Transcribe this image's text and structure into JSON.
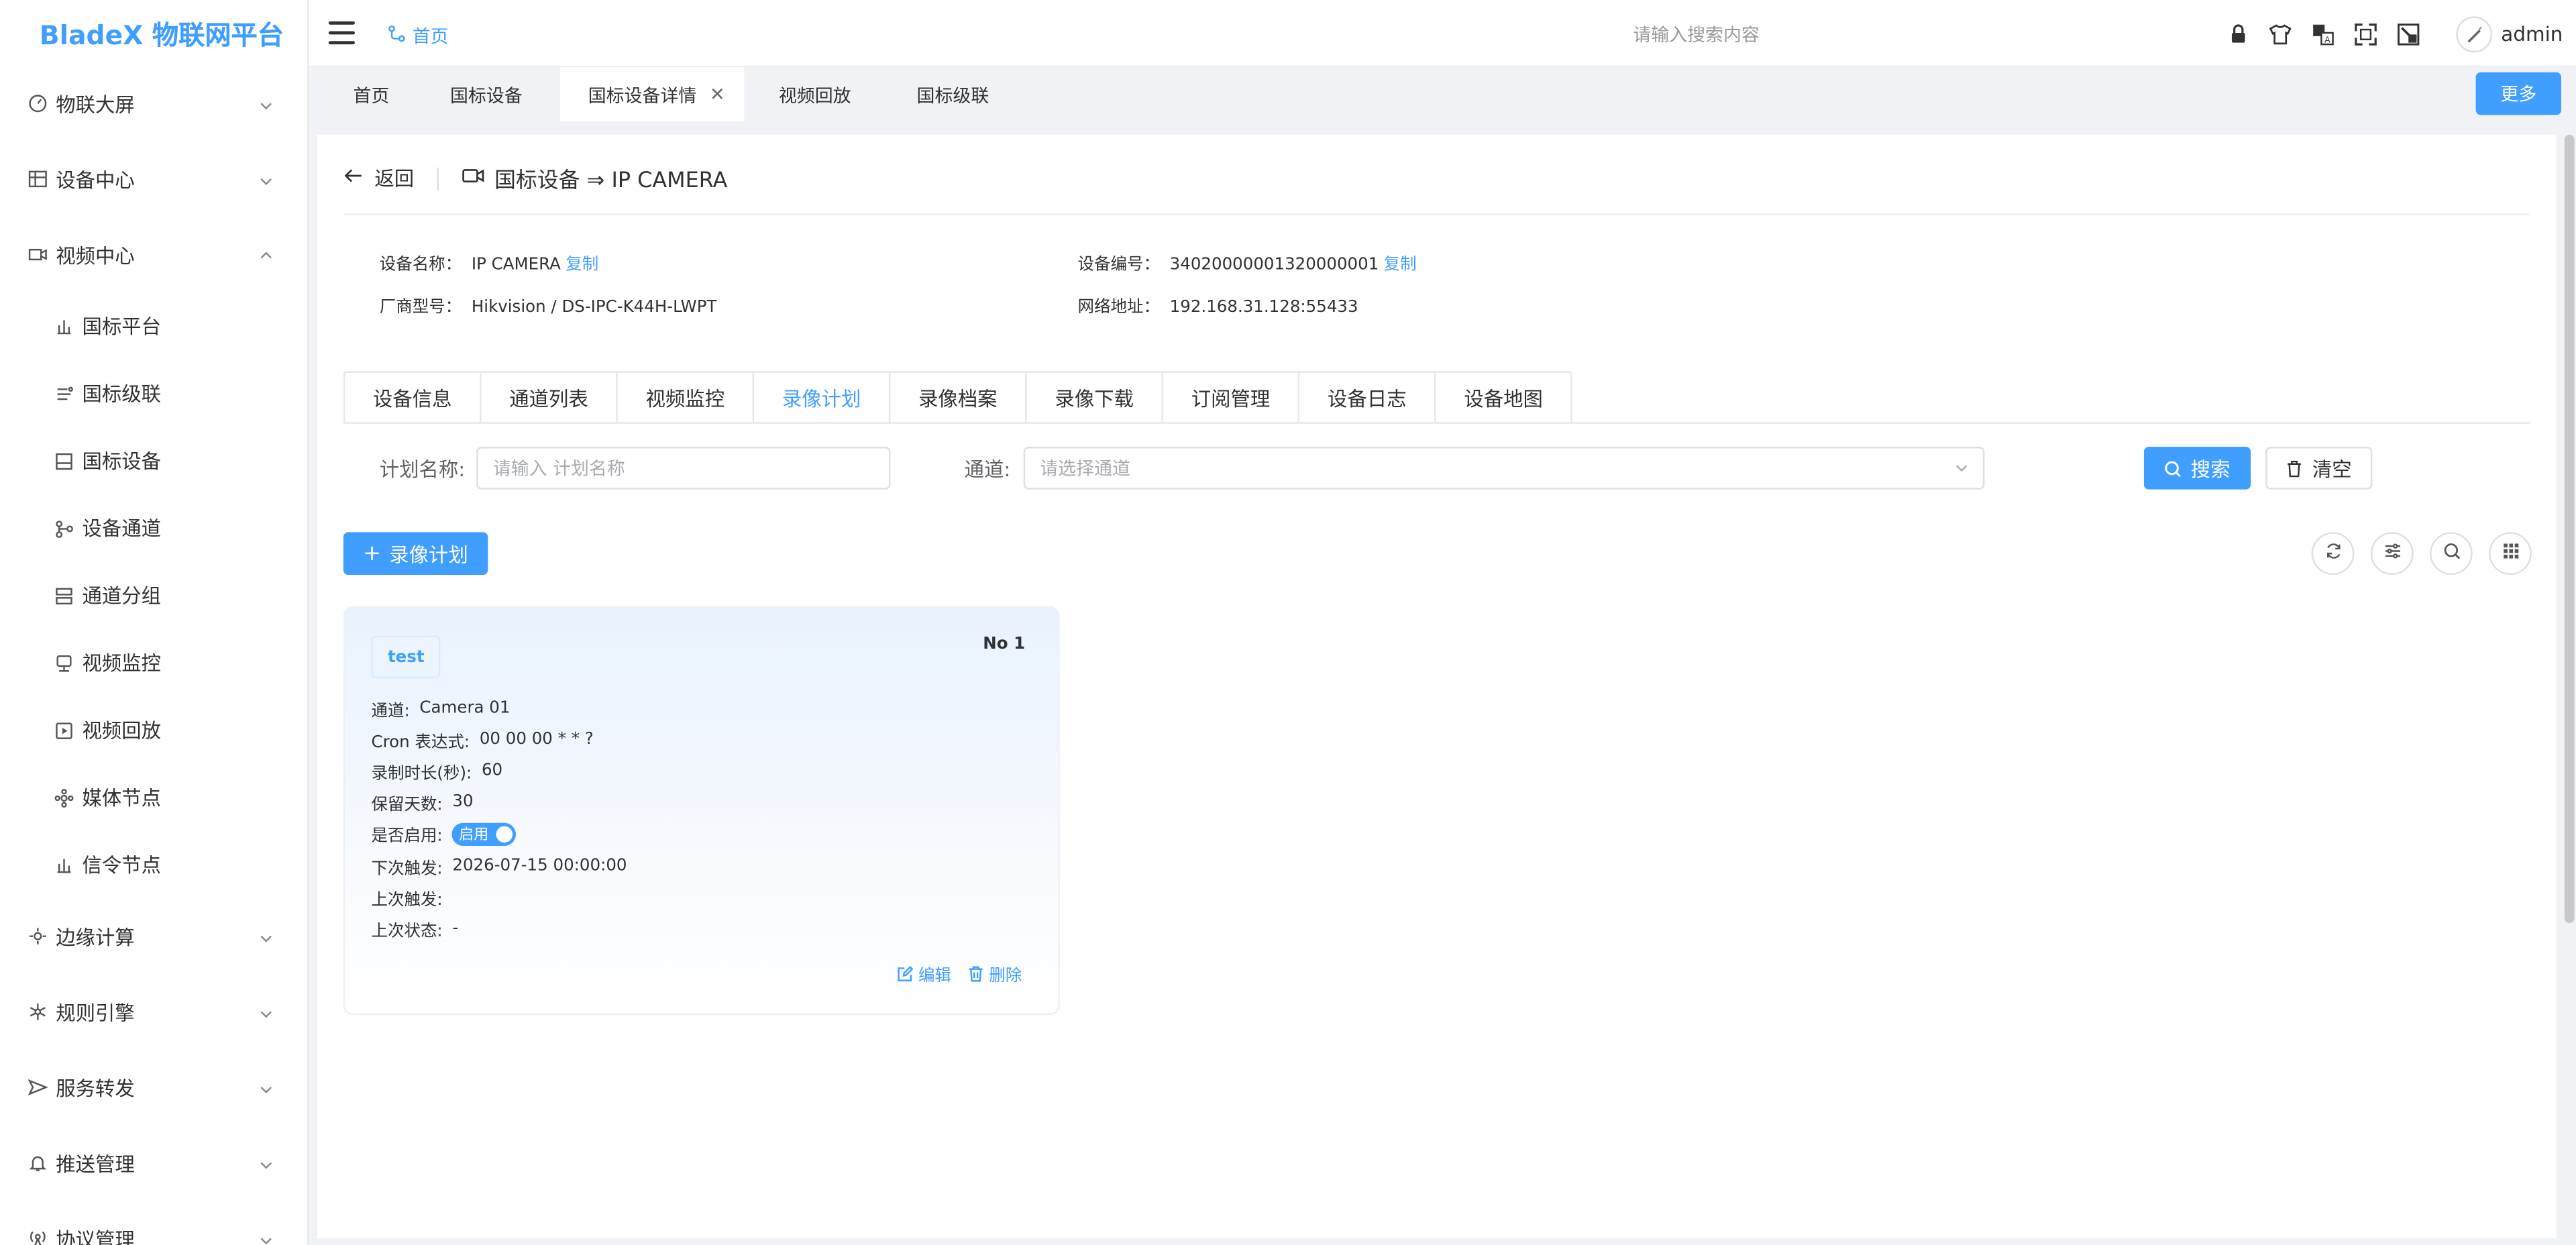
{
  "app": {
    "logo": "BladeX 物联网平台"
  },
  "header": {
    "home_crumb": "首页",
    "search_placeholder": "请输入搜索内容",
    "user_name": "admin"
  },
  "sidebar": {
    "items": [
      {
        "label": "物联大屏",
        "icon": "dashboard-icon",
        "expanded": false
      },
      {
        "label": "设备中心",
        "icon": "device-center-icon",
        "expanded": false
      },
      {
        "label": "视频中心",
        "icon": "video-icon",
        "expanded": true,
        "children": [
          {
            "label": "国标平台",
            "icon": "platform-icon"
          },
          {
            "label": "国标级联",
            "icon": "cascade-icon"
          },
          {
            "label": "国标设备",
            "icon": "device-icon"
          },
          {
            "label": "设备通道",
            "icon": "channel-icon"
          },
          {
            "label": "通道分组",
            "icon": "group-icon"
          },
          {
            "label": "视频监控",
            "icon": "monitor-icon"
          },
          {
            "label": "视频回放",
            "icon": "playback-icon"
          },
          {
            "label": "媒体节点",
            "icon": "media-node-icon"
          },
          {
            "label": "信令节点",
            "icon": "signal-node-icon"
          }
        ]
      },
      {
        "label": "边缘计算",
        "icon": "edge-icon",
        "expanded": false
      },
      {
        "label": "规则引擎",
        "icon": "rule-icon",
        "expanded": false
      },
      {
        "label": "服务转发",
        "icon": "forward-icon",
        "expanded": false
      },
      {
        "label": "推送管理",
        "icon": "bell-icon",
        "expanded": false
      },
      {
        "label": "协议管理",
        "icon": "protocol-icon",
        "expanded": false
      }
    ]
  },
  "tabs": [
    {
      "label": "首页"
    },
    {
      "label": "国标设备"
    },
    {
      "label": "国标设备详情",
      "active": true,
      "closable": true
    },
    {
      "label": "视频回放"
    },
    {
      "label": "国标级联"
    }
  ],
  "more_label": "更多",
  "detail": {
    "back_label": "返回",
    "title": "国标设备 ⇒ IP CAMERA",
    "info": {
      "name_key": "设备名称：",
      "name_value": "IP CAMERA",
      "code_key": "设备编号：",
      "code_value": "34020000001320000001",
      "vendor_key": "厂商型号：",
      "vendor_value": "Hikvision / DS-IPC-K44H-LWPT",
      "addr_key": "网络地址：",
      "addr_value": "192.168.31.128:55433",
      "copy_label": "复制"
    },
    "tabs": [
      "设备信息",
      "通道列表",
      "视频监控",
      "录像计划",
      "录像档案",
      "录像下载",
      "订阅管理",
      "设备日志",
      "设备地图"
    ],
    "active_tab": 3
  },
  "search": {
    "plan_label": "计划名称:",
    "plan_placeholder": "请输入 计划名称",
    "channel_label": "通道:",
    "channel_placeholder": "请选择通道",
    "search_btn": "搜索",
    "clear_btn": "清空"
  },
  "add_btn": "录像计划",
  "card": {
    "tag": "test",
    "no": "No 1",
    "rows": {
      "channel_key": "通道:",
      "channel_value": "Camera 01",
      "cron_key": "Cron 表达式:",
      "cron_value": "00 00 00 * * ?",
      "duration_key": "录制时长(秒):",
      "duration_value": "60",
      "retain_key": "保留天数:",
      "retain_value": "30",
      "enabled_key": "是否启用:",
      "enabled_value": "启用",
      "next_key": "下次触发:",
      "next_value": "2026-07-15 00:00:00",
      "last_key": "上次触发:",
      "last_value": "",
      "status_key": "上次状态:",
      "status_value": "-"
    },
    "edit_label": "编辑",
    "delete_label": "删除"
  },
  "colors": {
    "primary": "#409eff",
    "text": "#303133",
    "border": "#dcdfe6"
  }
}
